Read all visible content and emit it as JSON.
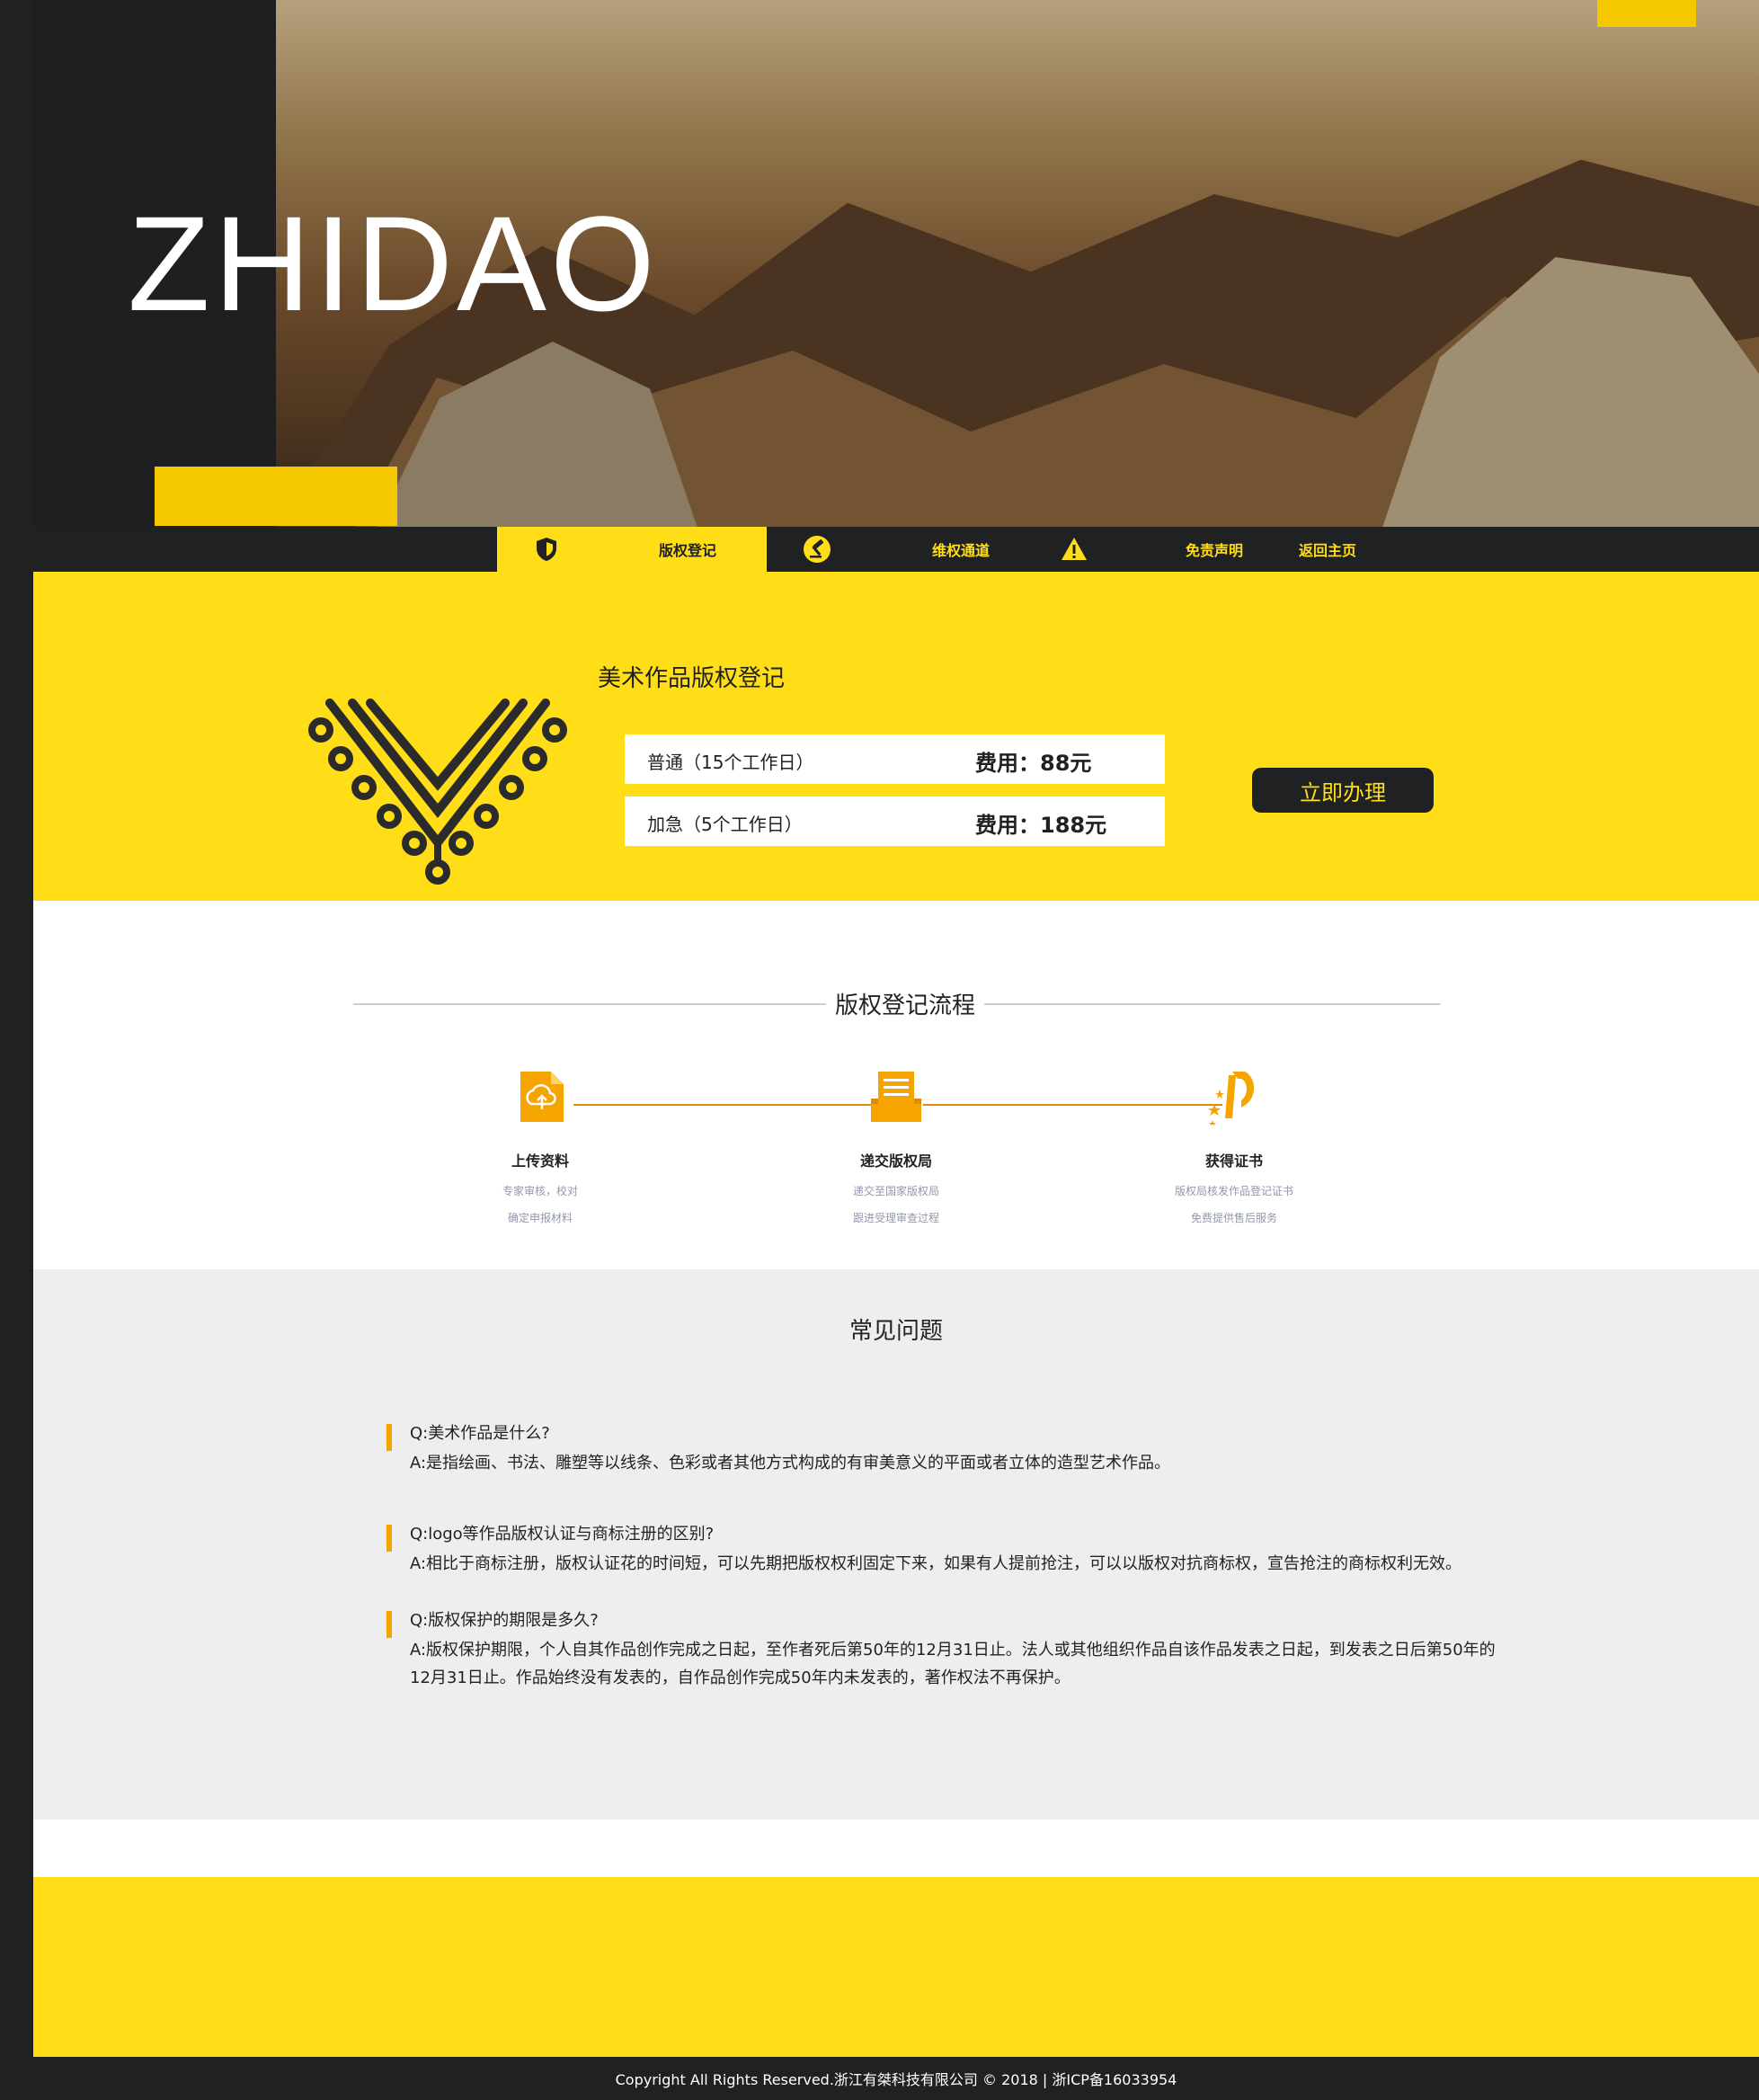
{
  "hero": {
    "logo": "ZHIDAO"
  },
  "nav": {
    "items": [
      {
        "label": "版权登记",
        "icon": "shield-icon"
      },
      {
        "label": "维权通道",
        "icon": "gavel-icon"
      },
      {
        "label": "免责声明",
        "icon": "warning-icon"
      },
      {
        "label": "返回主页"
      }
    ]
  },
  "registration": {
    "title": "美术作品版权登记",
    "options": [
      {
        "label": "普通（15个工作日）",
        "fee": "费用：88元"
      },
      {
        "label": "加急（5个工作日）",
        "fee": "费用：188元"
      }
    ],
    "apply_label": "立即办理"
  },
  "process": {
    "title": "版权登记流程",
    "steps": [
      {
        "title": "上传资料",
        "desc1": "专家审核，校对",
        "desc2": "确定申报材料",
        "icon": "cloud-upload-icon"
      },
      {
        "title": "递交版权局",
        "desc1": "递交至国家版权局",
        "desc2": "跟进受理审查过程",
        "icon": "document-icon"
      },
      {
        "title": "获得证书",
        "desc1": "版权局核发作品登记证书",
        "desc2": "免费提供售后服务",
        "icon": "certificate-icon"
      }
    ]
  },
  "faq": {
    "title": "常见问题",
    "items": [
      {
        "q": "Q:美术作品是什么?",
        "a": "A:是指绘画、书法、雕塑等以线条、色彩或者其他方式构成的有审美意义的平面或者立体的造型艺术作品。"
      },
      {
        "q": "Q:logo等作品版权认证与商标注册的区别?",
        "a": "A:相比于商标注册，版权认证花的时间短，可以先期把版权权利固定下来，如果有人提前抢注，可以以版权对抗商标权，宣告抢注的商标权利无效。"
      },
      {
        "q": "Q:版权保护的期限是多久?",
        "a": "A:版权保护期限，个人自其作品创作完成之日起，至作者死后第50年的12月31日止。法人或其他组织作品自该作品发表之日起，到发表之日后第50年的12月31日止。作品始终没有发表的，自作品创作完成50年内未发表的，著作权法不再保护。"
      }
    ]
  },
  "footer": {
    "text": "Copyright All Rights Reserved.浙江有桀科技有限公司 © 2018 | 浙ICP备16033954"
  },
  "colors": {
    "yellow": "#ffde18",
    "dark": "#1f2123",
    "grey_bg": "#eeeeee",
    "muted_text": "#9198ab",
    "accent_orange": "#f5a400"
  }
}
